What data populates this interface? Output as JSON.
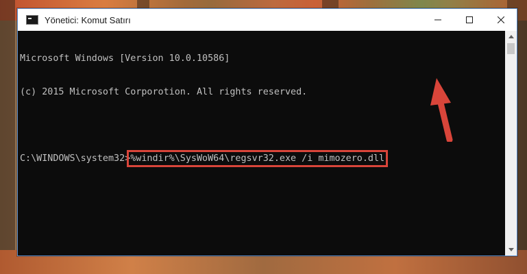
{
  "window": {
    "title": "Yönetici: Komut Satırı",
    "controls": {
      "minimize_icon": "minimize-icon",
      "maximize_icon": "maximize-icon",
      "close_icon": "close-icon"
    }
  },
  "console": {
    "lines": [
      "Microsoft Windows [Version 10.0.10586]",
      "(c) 2015 Microsoft Corporotion. All rights reserved.",
      ""
    ],
    "prompt": "C:\\WINDOWS\\system32>",
    "command": "%windir%\\SysWoW64\\regsvr32.exe /i mimozero.dll"
  },
  "annotation": {
    "color": "#d9453a"
  }
}
